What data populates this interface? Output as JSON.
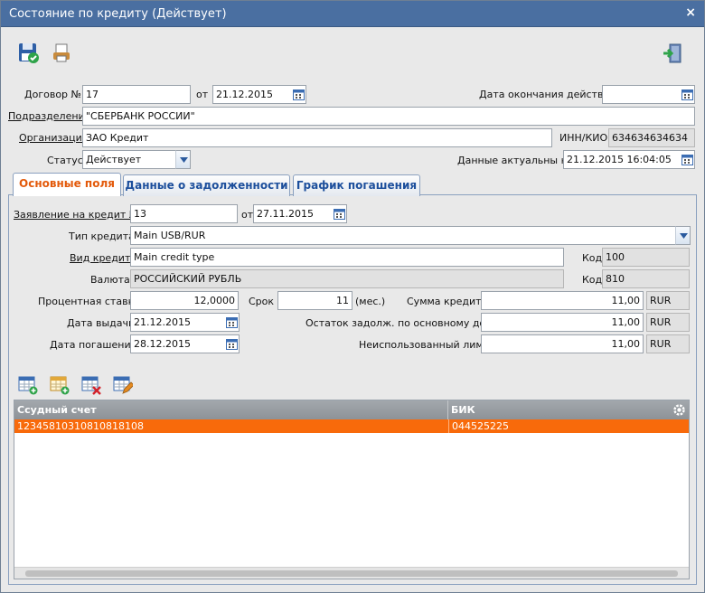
{
  "window": {
    "title": "Состояние по кредиту (Действует)",
    "close_label": "×"
  },
  "header": {
    "contract_label": "Договор №",
    "contract_value": "17",
    "from_label": "от",
    "contract_date": "21.12.2015",
    "end_date_label": "Дата окончания действия",
    "end_date_value": "",
    "division_label": "Подразделение",
    "division_value": "\"СБЕРБАНК РОССИИ\"",
    "org_label": "Организация",
    "org_value": "ЗАО Кредит",
    "inn_label": "ИНН/КИО",
    "inn_value": "634634634634",
    "status_label": "Статус",
    "status_value": "Действует",
    "actual_label": "Данные актуальны на",
    "actual_value": "21.12.2015 16:04:05"
  },
  "tabs": [
    {
      "label": "Основные поля"
    },
    {
      "label": "Данные о задолженности"
    },
    {
      "label": "График погашения"
    }
  ],
  "main": {
    "application_label": "Заявление на кредит №",
    "application_value": "13",
    "application_from_label": "от",
    "application_date": "27.11.2015",
    "credit_type_label": "Тип кредита",
    "credit_type_value": "Main USB/RUR",
    "kind_label": "Вид кредита",
    "kind_value": "Main credit type",
    "kind_code_label": "Код",
    "kind_code_value": "100",
    "currency_label": "Валюта",
    "currency_value": "РОССИЙСКИЙ РУБЛЬ",
    "currency_code_label": "Код",
    "currency_code_value": "810",
    "rate_label": "Процентная ставка",
    "rate_value": "12,0000",
    "term_label": "Срок",
    "term_value": "11",
    "term_unit": "(мес.)",
    "amount_label": "Сумма кредита",
    "amount_value": "11,00",
    "amount_cur": "RUR",
    "issue_label": "Дата выдачи",
    "issue_value": "21.12.2015",
    "debt_label": "Остаток задолж. по основному долгу",
    "debt_value": "11,00",
    "debt_cur": "RUR",
    "repay_label": "Дата погашения",
    "repay_value": "28.12.2015",
    "unused_label": "Неиспользованный лимит",
    "unused_value": "11,00",
    "unused_cur": "RUR"
  },
  "grid": {
    "columns": [
      "Ссудный счет",
      "БИК"
    ],
    "rows": [
      [
        "12345810310810818108",
        "044525225"
      ]
    ]
  },
  "colors": {
    "accent": "#f86a0b",
    "titlebar": "#4a6fa1",
    "tab_active": "#e35a0b"
  }
}
